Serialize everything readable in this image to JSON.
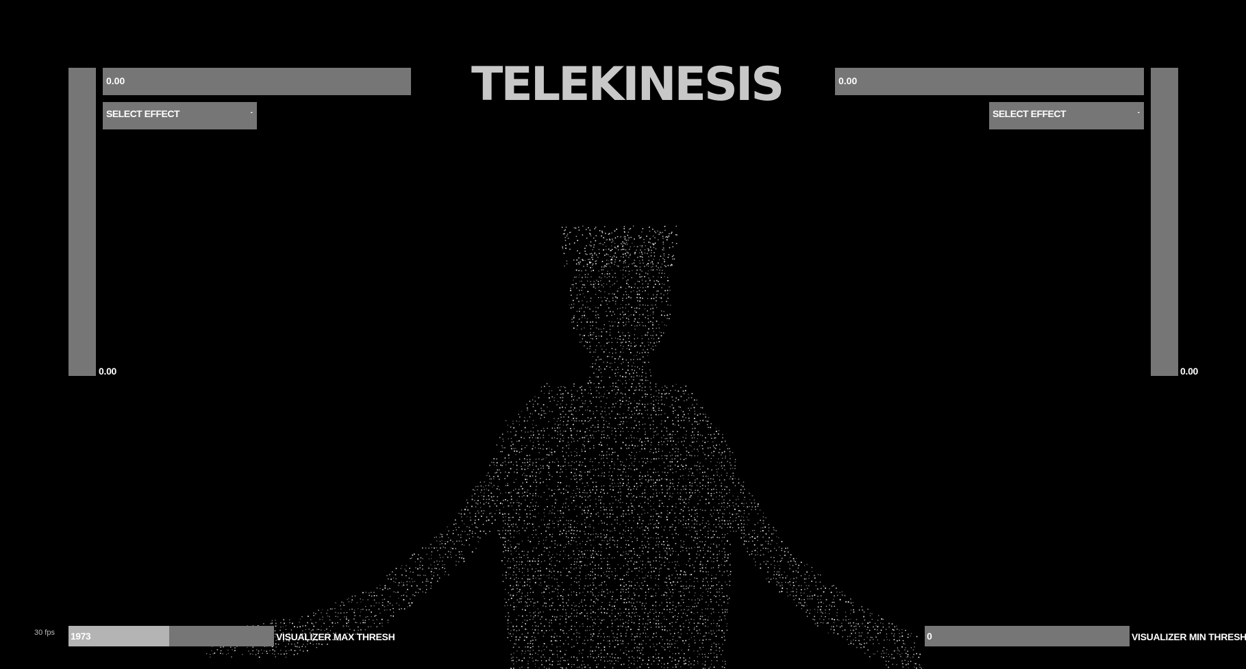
{
  "title": "TELEKINESIS",
  "left_panel": {
    "horizontal_value": "0.00",
    "vertical_value": "0.00",
    "select_effect_label": "SELECT EFFECT",
    "caret": "-"
  },
  "right_panel": {
    "horizontal_value": "0.00",
    "vertical_value": "0.00",
    "select_effect_label": "SELECT EFFECT",
    "caret": "-"
  },
  "status": {
    "fps": "30 fps"
  },
  "sliders": {
    "max_thresh": {
      "value": "1973",
      "label": "VISUALIZER MAX THRESH",
      "fill_fraction": 0.49
    },
    "min_thresh": {
      "value": "0",
      "label": "VISUALIZER MIN THRESH",
      "fill_fraction": 0.0
    }
  },
  "colors": {
    "background": "#000000",
    "control_gray": "#767676",
    "slider_fill": "#b4b4b4",
    "title_gray": "#c8c8c8",
    "text": "#ffffff"
  }
}
